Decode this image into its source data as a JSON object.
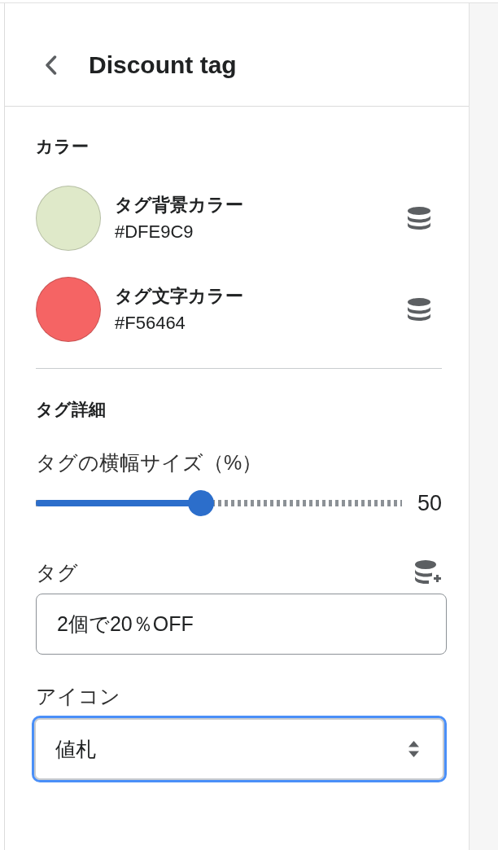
{
  "header": {
    "title": "Discount tag"
  },
  "colors": {
    "heading": "カラー",
    "items": [
      {
        "label": "タグ背景カラー",
        "value": "#DFE9C9",
        "color": "#dfe9c9"
      },
      {
        "label": "タグ文字カラー",
        "value": "#F56464",
        "color": "#f56464"
      }
    ]
  },
  "details": {
    "heading": "タグ詳細",
    "fields": [
      {
        "kind": "slider",
        "label": "タグの横幅サイズ（%）",
        "level": 0.45,
        "reading": "50"
      },
      {
        "kind": "text",
        "label": "タグ",
        "value": "2個で20％OFF"
      },
      {
        "kind": "select",
        "label": "アイコン",
        "value": "値札",
        "focused": true
      }
    ]
  }
}
